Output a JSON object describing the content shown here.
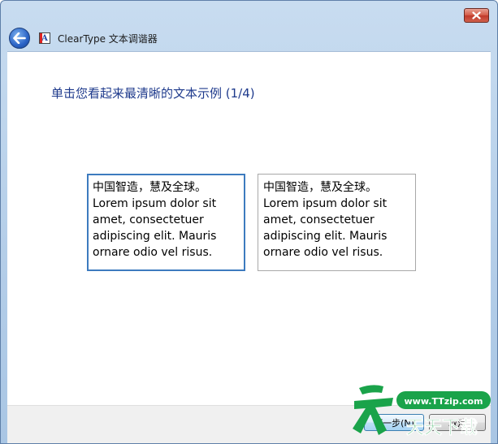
{
  "window": {
    "title": "ClearType 文本调谐器",
    "app_icon_glyph": "A",
    "close_icon": "close-icon",
    "back_icon": "back-arrow-icon"
  },
  "main": {
    "heading": "单击您看起来最清晰的文本示例 (1/4)",
    "samples": [
      {
        "lines": [
          "中国智造，慧及全球。",
          "Lorem ipsum dolor sit",
          "amet, consectetuer",
          "adipiscing elit. Mauris",
          "ornare odio vel risus."
        ],
        "selected": true
      },
      {
        "lines": [
          "中国智造，慧及全球。",
          "Lorem ipsum dolor sit",
          "amet, consectetuer",
          "adipiscing elit. Mauris",
          "ornare odio vel risus."
        ],
        "selected": false
      }
    ]
  },
  "footer": {
    "next_label": "下一步(N)",
    "cancel_label": "取消"
  },
  "watermark": {
    "site": "www.TTzip.com",
    "text": "天天下载"
  },
  "colors": {
    "heading": "#1e3a8c",
    "selected_border": "#3d7bbf",
    "watermark_green": "#1aa34a"
  }
}
